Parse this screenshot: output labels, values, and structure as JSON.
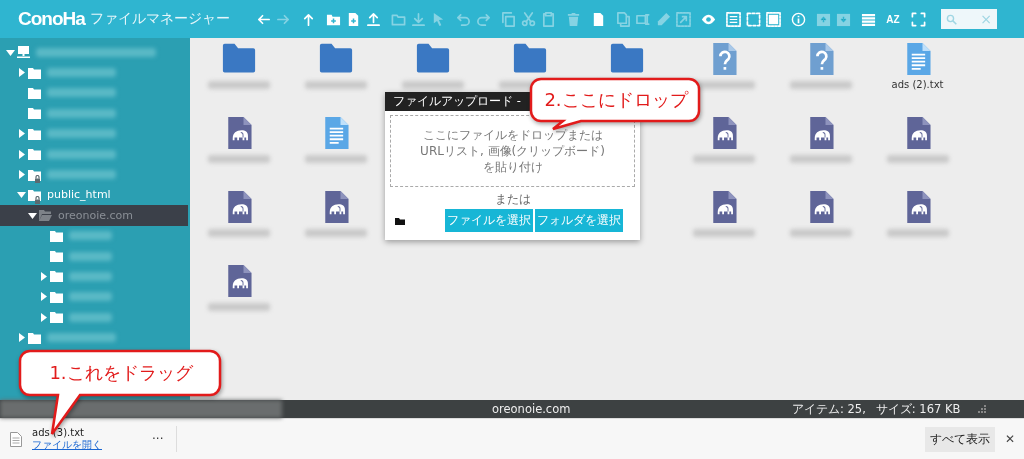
{
  "app": {
    "logo": "ConoHa",
    "title": "ファイルマネージャー"
  },
  "toolbar": {
    "groups": [
      [
        {
          "kind": "back",
          "disabled": false
        },
        {
          "kind": "forward",
          "disabled": true
        }
      ],
      [
        {
          "kind": "up",
          "disabled": false
        }
      ],
      [
        {
          "kind": "folder-plus",
          "disabled": false
        },
        {
          "kind": "file-plus",
          "disabled": false
        },
        {
          "kind": "upload",
          "disabled": false
        }
      ],
      [
        {
          "kind": "folder",
          "disabled": true
        },
        {
          "kind": "download",
          "disabled": true
        },
        {
          "kind": "cursor",
          "disabled": true
        }
      ],
      [
        {
          "kind": "undo",
          "disabled": true
        },
        {
          "kind": "redo",
          "disabled": true
        }
      ],
      [
        {
          "kind": "copy",
          "disabled": true
        },
        {
          "kind": "cut",
          "disabled": true
        },
        {
          "kind": "paste",
          "disabled": true
        }
      ],
      [
        {
          "kind": "trash",
          "disabled": true
        }
      ],
      [
        {
          "kind": "file",
          "disabled": false
        }
      ],
      [
        {
          "kind": "duplicate",
          "disabled": true
        },
        {
          "kind": "textbox",
          "disabled": true
        },
        {
          "kind": "pencil",
          "disabled": true
        },
        {
          "kind": "resize",
          "disabled": true
        }
      ],
      [
        {
          "kind": "eye",
          "disabled": false
        }
      ],
      [
        {
          "kind": "select-all",
          "disabled": false
        },
        {
          "kind": "deselect",
          "disabled": false
        },
        {
          "kind": "invert",
          "disabled": false
        }
      ],
      [
        {
          "kind": "info",
          "disabled": false
        }
      ],
      [
        {
          "kind": "archive",
          "disabled": true
        },
        {
          "kind": "extract",
          "disabled": true
        }
      ],
      [
        {
          "kind": "list",
          "disabled": false
        }
      ],
      [
        {
          "kind": "sort",
          "disabled": false,
          "text": "AZ"
        }
      ],
      [
        {
          "kind": "fullscreen",
          "disabled": false
        }
      ]
    ],
    "search": {
      "clear": "×"
    }
  },
  "tree": [
    {
      "kind": "server",
      "expanded": true,
      "selected": false,
      "children": [
        {
          "kind": "folder",
          "expanded": false,
          "selected": false
        },
        {
          "kind": "folder",
          "selected": false
        },
        {
          "kind": "folder",
          "selected": false
        },
        {
          "kind": "folder",
          "expanded": false,
          "selected": false
        },
        {
          "kind": "folder",
          "expanded": false,
          "selected": false
        },
        {
          "kind": "folder",
          "expanded": false,
          "selected": false,
          "locked": true
        },
        {
          "kind": "folder",
          "label": "public_html",
          "expanded": true,
          "selected": false,
          "locked": true,
          "children": [
            {
              "kind": "folder",
              "label": "oreonoie.com",
              "expanded": true,
              "selected": true,
              "children": [
                {
                  "kind": "folder",
                  "selected": false
                },
                {
                  "kind": "folder",
                  "selected": false
                },
                {
                  "kind": "folder",
                  "expanded": false,
                  "selected": false
                },
                {
                  "kind": "folder",
                  "expanded": false,
                  "selected": false
                },
                {
                  "kind": "folder",
                  "expanded": false,
                  "selected": false
                }
              ]
            }
          ]
        },
        {
          "kind": "folder",
          "expanded": false,
          "selected": false
        }
      ]
    }
  ],
  "files": [
    [
      {
        "kind": "folder"
      },
      {
        "kind": "folder"
      },
      {
        "kind": "folder"
      },
      {
        "kind": "folder"
      },
      {
        "kind": "folder"
      },
      {
        "kind": "unknown"
      },
      {
        "kind": "unknown"
      },
      {
        "kind": "text",
        "label": "ads (2).txt"
      }
    ],
    [
      {
        "kind": "php"
      },
      {
        "kind": "text"
      },
      {
        "kind": "covered"
      },
      {
        "kind": "covered"
      },
      {
        "kind": "covered"
      },
      {
        "kind": "php"
      },
      {
        "kind": "php"
      },
      {
        "kind": "php"
      }
    ],
    [
      {
        "kind": "php"
      },
      {
        "kind": "php"
      },
      {
        "kind": "covered"
      },
      {
        "kind": "covered"
      },
      {
        "kind": "covered"
      },
      {
        "kind": "php"
      },
      {
        "kind": "php"
      },
      {
        "kind": "php"
      }
    ],
    [
      {
        "kind": "php"
      }
    ]
  ],
  "upload_dialog": {
    "title": "ファイルアップロード -",
    "drop_text": [
      "ここにファイルをドロップまたは",
      "URLリスト, 画像(クリップボード)",
      "を貼り付け"
    ],
    "or": "または",
    "buttons": [
      "ファイルを選択",
      "フォルダを選択"
    ]
  },
  "status_bar": {
    "path": "oreonoie.com",
    "items": "アイテム: 25,",
    "size": "サイズ: 167 KB"
  },
  "download_bar": {
    "file": "ads (3).txt",
    "open_link": "ファイルを開く",
    "more": "···",
    "show_all": "すべて表示",
    "close": "✕"
  },
  "callouts": [
    {
      "text": "1.これをドラッグ"
    },
    {
      "text": "2.ここにドロップ"
    }
  ]
}
